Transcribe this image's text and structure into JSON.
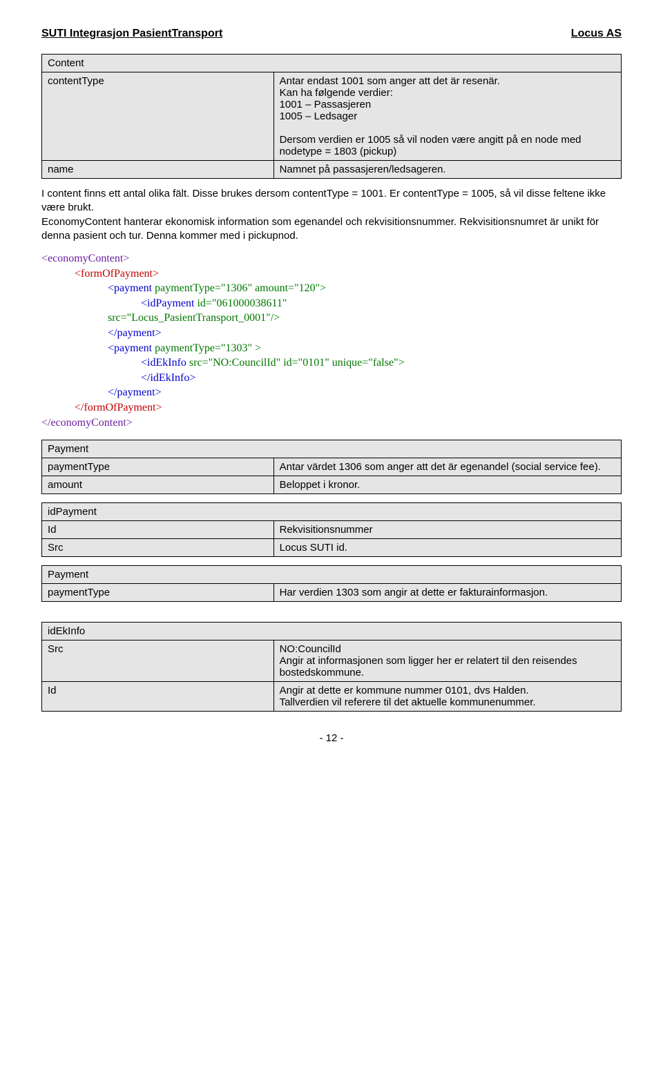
{
  "header": {
    "left": "SUTI Integrasjon PasientTransport",
    "right": "Locus AS"
  },
  "table_content": {
    "title": "Content",
    "row1_label": "contentType",
    "row1_value": "Antar endast 1001 som anger att det är resenär.\nKan ha følgende verdier:\n1001 – Passasjeren\n1005 – Ledsager\n\nDersom verdien er 1005 så vil noden være angitt på en node med nodetype = 1803 (pickup)",
    "row2_label": "name",
    "row2_value": "Namnet på passasjeren/ledsageren."
  },
  "para1": "I content finns ett antal olika fält. Disse brukes dersom contentType = 1001. Er contentType = 1005, så vil disse feltene ikke være brukt.\nEconomyContent hanterar ekonomisk information som egenandel och rekvisitionsnummer. Rekvisitionsnumret är unikt för denna pasient och tur. Denna kommer med i pickupnod.",
  "xml": {
    "l1": "<economyContent>",
    "l2": "<formOfPayment>",
    "l3a": "<payment",
    "l3b": " paymentType=\"1306\" amount=\"120\">",
    "l4a": "<idPayment",
    "l4b": " id=\"061000038611\"",
    "l5": "src=\"Locus_PasientTransport_0001\"/>",
    "l6": "</payment>",
    "l7a": "<payment",
    "l7b": " paymentType=\"1303\" >",
    "l8a": "<idEkInfo",
    "l8b": " src=\"NO:CouncilId\" id=\"0101\" unique=\"false\">",
    "l9": "</idEkInfo>",
    "l10": "</payment>",
    "l11": "</formOfPayment>",
    "l12": "</economyContent>"
  },
  "table_payment1": {
    "title": "Payment",
    "row1_label": "paymentType",
    "row1_value": "Antar värdet 1306 som anger att det är egenandel (social service fee).",
    "row2_label": "amount",
    "row2_value": "Beloppet i kronor."
  },
  "table_idpayment": {
    "title": "idPayment",
    "row1_label": "Id",
    "row1_value": "Rekvisitionsnummer",
    "row2_label": "Src",
    "row2_value": "Locus SUTI id."
  },
  "table_payment2": {
    "title": "Payment",
    "row1_label": "paymentType",
    "row1_value": "Har verdien 1303 som angir at dette er fakturainformasjon."
  },
  "table_idekinfo": {
    "title": "idEkInfo",
    "row1_label": "Src",
    "row1_value": "NO:CouncilId\nAngir at informasjonen som ligger her er relatert til den reisendes bostedskommune.",
    "row2_label": "Id",
    "row2_value": "Angir at dette er kommune nummer 0101, dvs Halden.\nTallverdien vil referere til det aktuelle kommunenummer."
  },
  "footer": "- 12 -"
}
